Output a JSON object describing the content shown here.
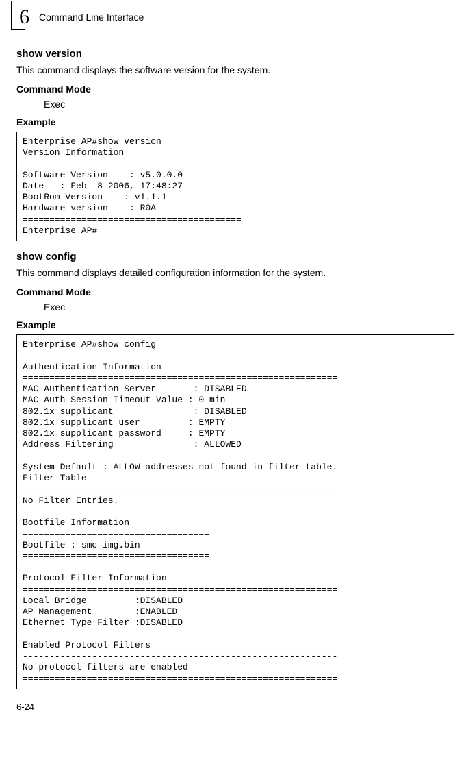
{
  "chapter": {
    "number": "6",
    "title": "Command Line Interface"
  },
  "section1": {
    "title": "show version",
    "description": "This command displays the software version for the system.",
    "command_mode_label": "Command Mode",
    "command_mode_value": "Exec",
    "example_label": "Example",
    "example_text": "Enterprise AP#show version\nVersion Information\n=========================================\nSoftware Version    : v5.0.0.0\nDate   : Feb  8 2006, 17:48:27\nBootRom Version    : v1.1.1\nHardware version    : R0A\n=========================================\nEnterprise AP#"
  },
  "section2": {
    "title": "show config",
    "description": "This command displays detailed configuration information for the system.",
    "command_mode_label": "Command Mode",
    "command_mode_value": "Exec",
    "example_label": "Example",
    "example_text": "Enterprise AP#show config\n\nAuthentication Information\n===========================================================\nMAC Authentication Server       : DISABLED\nMAC Auth Session Timeout Value : 0 min\n802.1x supplicant               : DISABLED\n802.1x supplicant user         : EMPTY\n802.1x supplicant password     : EMPTY\nAddress Filtering               : ALLOWED\n\nSystem Default : ALLOW addresses not found in filter table.\nFilter Table\n-----------------------------------------------------------\nNo Filter Entries.\n\nBootfile Information\n===================================\nBootfile : smc-img.bin\n===================================\n\nProtocol Filter Information\n===========================================================\nLocal Bridge         :DISABLED\nAP Management        :ENABLED\nEthernet Type Filter :DISABLED\n\nEnabled Protocol Filters\n-----------------------------------------------------------\nNo protocol filters are enabled\n==========================================================="
  },
  "page_number": "6-24"
}
